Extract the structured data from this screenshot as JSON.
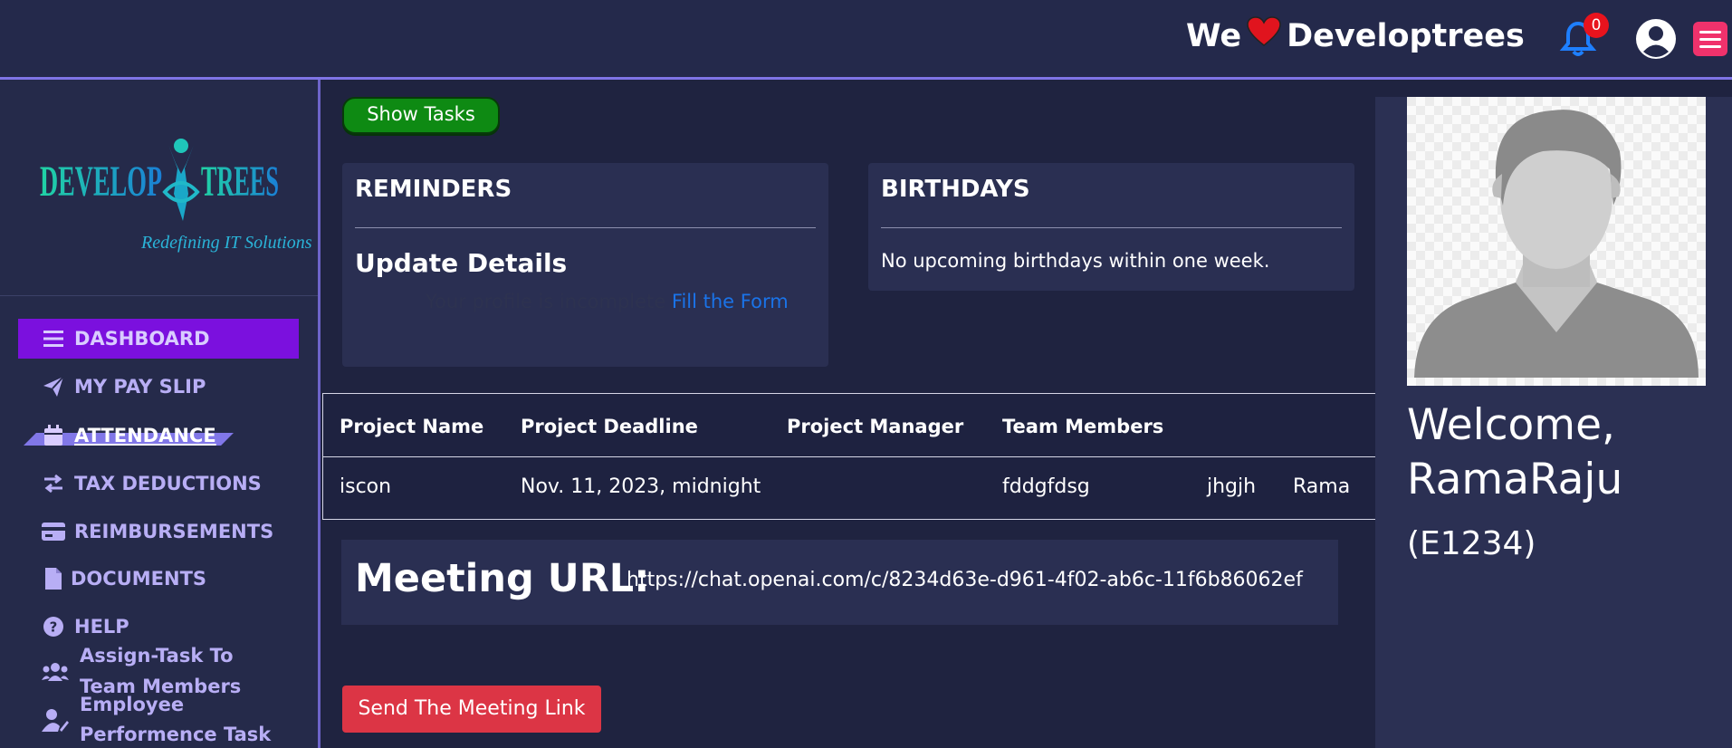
{
  "header": {
    "brand_left": "We",
    "brand_right": "Developtrees",
    "notification_count": "0"
  },
  "sidebar": {
    "logo": {
      "name_left": "DEVELOP",
      "name_right": "TREES",
      "tagline": "Redefining IT Solutions"
    },
    "items": [
      {
        "label": "DASHBOARD",
        "icon": "bars-icon"
      },
      {
        "label": "MY PAY SLIP",
        "icon": "paper-plane-icon"
      },
      {
        "label": "ATTENDANCE",
        "icon": "calendar-icon"
      },
      {
        "label": "TAX DEDUCTIONS",
        "icon": "exchange-icon"
      },
      {
        "label": "REIMBURSEMENTS",
        "icon": "credit-card-icon"
      },
      {
        "label": "DOCUMENTS",
        "icon": "file-icon"
      },
      {
        "label": "HELP",
        "icon": "question-circle-icon"
      },
      {
        "label_line1": "Assign-Task To",
        "label_line2": "Team Members",
        "icon": "users-icon"
      },
      {
        "label_line1": "Employee",
        "label_line2": "Performence Task",
        "icon": "user-edit-icon"
      }
    ]
  },
  "main": {
    "show_tasks_label": "Show Tasks",
    "reminders": {
      "title": "REMINDERS",
      "subtitle": "Update Details",
      "message": "Your profile is incomplete",
      "link": "Fill the Form"
    },
    "birthdays": {
      "title": "BIRTHDAYS",
      "message": "No upcoming birthdays within one week."
    },
    "projects_table": {
      "headers": [
        "Project Name",
        "Project Deadline",
        "Project Manager",
        "Team Members"
      ],
      "rows": [
        {
          "project_name": "iscon",
          "deadline": "Nov. 11, 2023, midnight",
          "manager": "",
          "members": [
            "fddgfdsg",
            "jhgjh",
            "Rama"
          ]
        }
      ]
    },
    "meeting": {
      "label": "Meeting URL:",
      "url": "https://chat.openai.com/c/8234d63e-d961-4f02-ab6c-11f6b86062ef"
    },
    "send_label": "Send The Meeting Link"
  },
  "profile": {
    "welcome_line1": "Welcome,",
    "welcome_line2": "RamaRaju",
    "employee_id": "(E1234)"
  },
  "colors": {
    "accent_active": "#7b10de",
    "nav_text": "#b8aef5",
    "show_tasks_green": "#0e8a13",
    "send_button_red": "#dc3545",
    "link_blue": "#1a73e8",
    "logo_teal": "#18c7b5"
  }
}
